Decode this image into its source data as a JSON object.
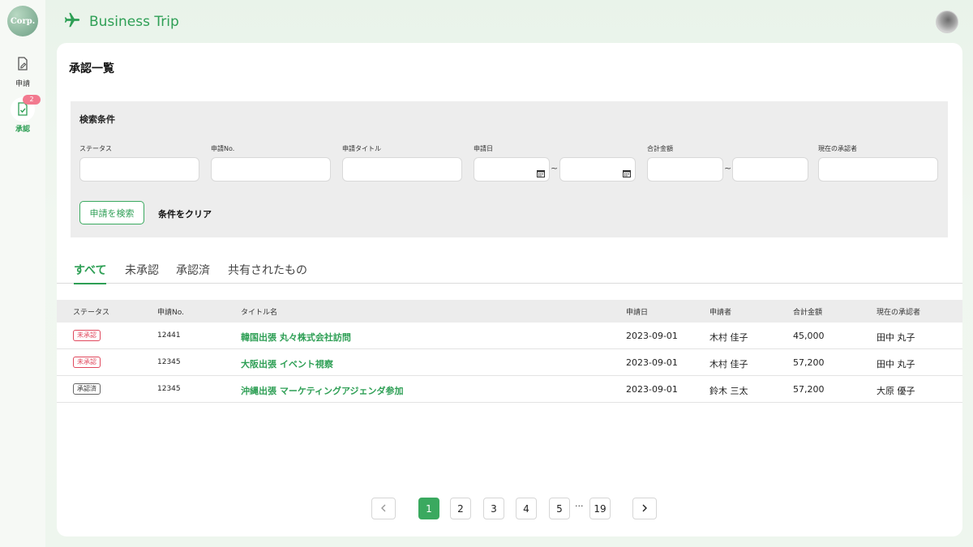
{
  "sidebar": {
    "logo_text": "Corp.",
    "items": [
      {
        "label": "申請",
        "icon": "document-edit-icon"
      },
      {
        "label": "承認",
        "icon": "document-check-icon",
        "badge": "2"
      }
    ]
  },
  "header": {
    "app_icon": "airplane-icon",
    "title": "Business Trip"
  },
  "page": {
    "title": "承認一覧"
  },
  "search": {
    "heading": "検索条件",
    "labels": {
      "status": "ステータス",
      "number": "申請No.",
      "title": "申請タイトル",
      "date": "申請日",
      "amount": "合計金額",
      "approver": "現在の承認者"
    },
    "range_sep": "~",
    "search_button": "申請を検索",
    "clear_button": "条件をクリア"
  },
  "tabs": [
    "すべて",
    "未承認",
    "承認済",
    "共有されたもの"
  ],
  "table": {
    "headers": [
      "ステータス",
      "申請No.",
      "タイトル名",
      "申請日",
      "申請者",
      "合計金額",
      "現在の承認者"
    ],
    "rows": [
      {
        "status": "未承認",
        "no": "12441",
        "title": "韓国出張 丸々株式会社訪問",
        "date": "2023-09-01",
        "applicant": "木村 佳子",
        "amount": "45,000",
        "approver": "田中 丸子"
      },
      {
        "status": "未承認",
        "no": "12345",
        "title": "大阪出張 イベント視察",
        "date": "2023-09-01",
        "applicant": "木村 佳子",
        "amount": "57,200",
        "approver": "田中 丸子"
      },
      {
        "status": "承認済",
        "no": "12345",
        "title": "沖縄出張 マーケティングアジェンダ参加",
        "date": "2023-09-01",
        "applicant": "鈴木 三太",
        "amount": "57,200",
        "approver": "大原 優子"
      }
    ]
  },
  "pagination": {
    "pages": [
      "1",
      "2",
      "3",
      "4",
      "5"
    ],
    "ellipsis": "···",
    "last": "19",
    "current": "1"
  },
  "colors": {
    "accent": "#2e9f55",
    "pending": "#e0485d",
    "badge": "#f27a8f"
  }
}
